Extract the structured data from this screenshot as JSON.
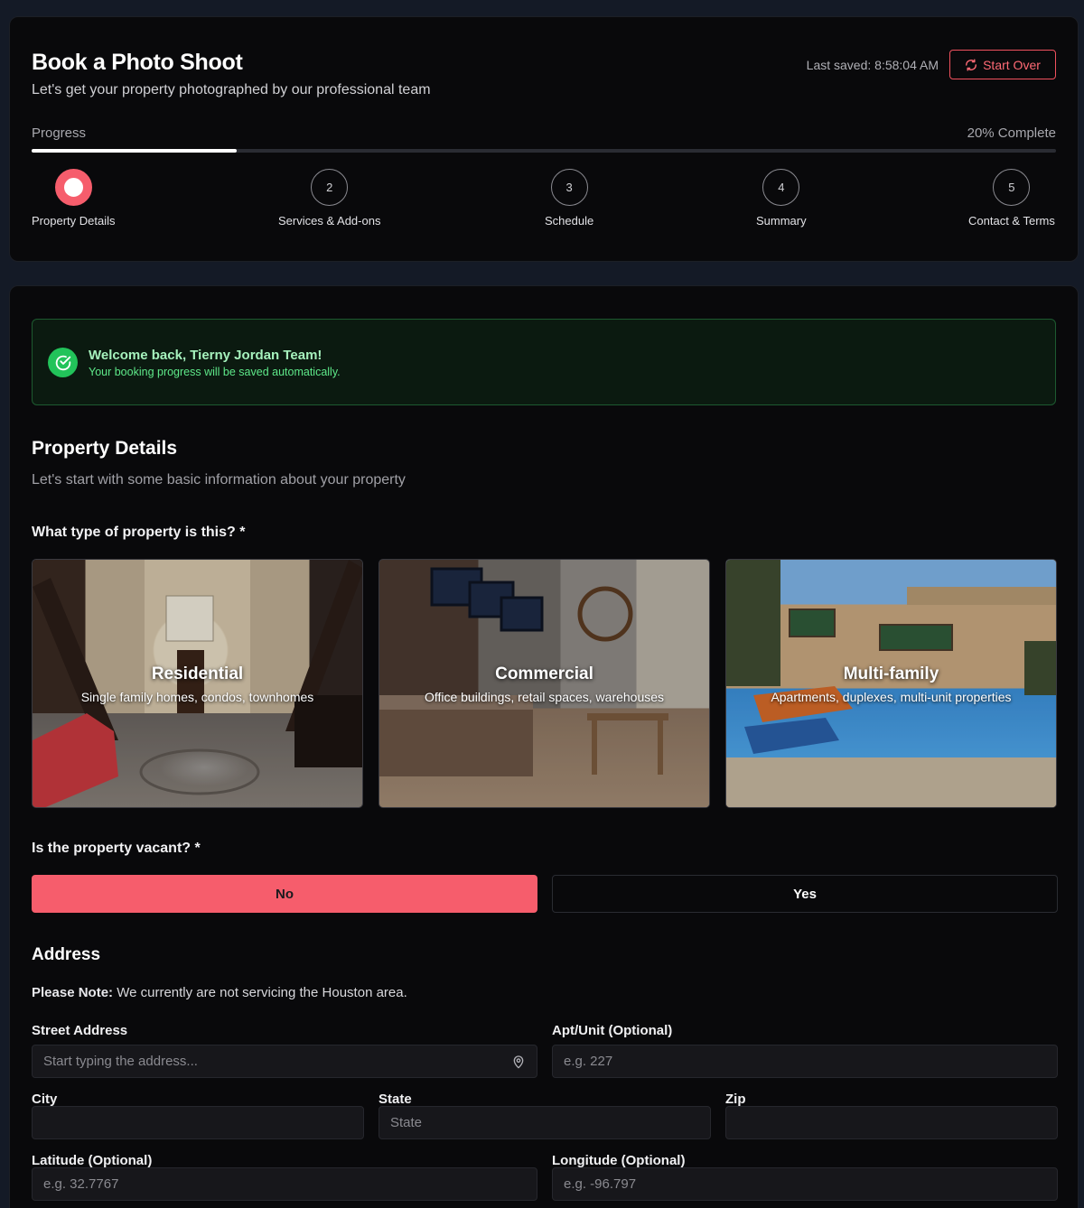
{
  "header": {
    "title": "Book a Photo Shoot",
    "subtitle": "Let's get your property photographed by our professional team",
    "last_saved": "Last saved: 8:58:04 AM",
    "start_over_label": "Start Over"
  },
  "progress": {
    "label": "Progress",
    "percent_text": "20% Complete",
    "percent": 20,
    "steps": [
      {
        "number": "1",
        "label": "Property Details",
        "active": true
      },
      {
        "number": "2",
        "label": "Services & Add-ons",
        "active": false
      },
      {
        "number": "3",
        "label": "Schedule",
        "active": false
      },
      {
        "number": "4",
        "label": "Summary",
        "active": false
      },
      {
        "number": "5",
        "label": "Contact & Terms",
        "active": false
      }
    ]
  },
  "welcome": {
    "title": "Welcome back, Tierny Jordan Team!",
    "text": "Your booking progress will be saved automatically."
  },
  "property_details": {
    "heading": "Property Details",
    "intro": "Let's start with some basic information about your property",
    "type_question": "What type of property is this? *",
    "types": [
      {
        "title": "Residential",
        "description": "Single family homes, condos, townhomes"
      },
      {
        "title": "Commercial",
        "description": "Office buildings, retail spaces, warehouses"
      },
      {
        "title": "Multi-family",
        "description": "Apartments, duplexes, multi-unit properties"
      }
    ],
    "vacant_question": "Is the property vacant? *",
    "vacant_options": [
      {
        "label": "No",
        "selected": true
      },
      {
        "label": "Yes",
        "selected": false
      }
    ]
  },
  "address": {
    "heading": "Address",
    "note_bold": "Please Note:",
    "note_text": " We currently are not servicing the Houston area.",
    "street_label": "Street Address",
    "street_placeholder": "Start typing the address...",
    "apt_label": "Apt/Unit (Optional)",
    "apt_placeholder": "e.g. 227",
    "city_label": "City",
    "city_placeholder": "",
    "state_label": "State",
    "state_placeholder": "State",
    "zip_label": "Zip",
    "zip_placeholder": "",
    "lat_label": "Latitude (Optional)",
    "lat_placeholder": "e.g. 32.7767",
    "lng_label": "Longitude (Optional)",
    "lng_placeholder": "e.g. -96.797"
  },
  "colors": {
    "accent": "#f65d6c",
    "success": "#22c35a",
    "background": "#09090b"
  }
}
